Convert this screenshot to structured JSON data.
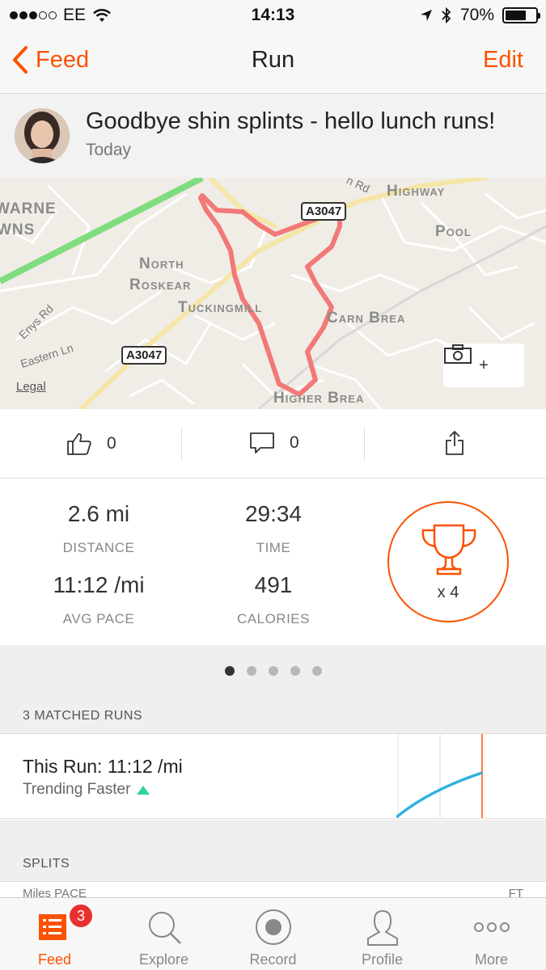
{
  "status_bar": {
    "carrier": "EE",
    "time": "14:13",
    "battery": "70%",
    "battery_level": 0.7
  },
  "nav": {
    "back_label": "Feed",
    "title": "Run",
    "edit_label": "Edit"
  },
  "activity": {
    "title": "Goodbye shin splints - hello lunch runs!",
    "date": "Today"
  },
  "map": {
    "labels": {
      "warne": "WARNE",
      "wns": "WNS",
      "north": "North",
      "roskear": "Roskear",
      "tuckingmill": "Tuckingmill",
      "highway": "Highway",
      "pool": "Pool",
      "carn_brea": "Carn Brea",
      "higher_brea": "Higher Brea",
      "enys_rd": "Enys Rd",
      "eastern_ln": "Eastern Ln",
      "rd": "n Rd",
      "a3047_top": "A3047",
      "a3047_bottom": "A3047"
    },
    "legal": "Legal",
    "photo_plus": "+"
  },
  "social": {
    "kudos_count": "0",
    "comment_count": "0"
  },
  "stats": {
    "distance": {
      "value": "2.6 mi",
      "label": "DISTANCE"
    },
    "time": {
      "value": "29:34",
      "label": "TIME"
    },
    "avg_pace": {
      "value": "11:12 /mi",
      "label": "AVG PACE"
    },
    "calories": {
      "value": "491",
      "label": "CALORIES"
    },
    "trophies": "x 4"
  },
  "pager": {
    "pages": 5,
    "active": 0
  },
  "matched": {
    "header": "3 MATCHED RUNS",
    "title": "This Run: 11:12 /mi",
    "subtitle": "Trending Faster",
    "trend_color": "#2ed3a4"
  },
  "splits": {
    "header": "SPLITS",
    "col_left": "Miles   PACE",
    "col_right": "FT"
  },
  "tabs": [
    {
      "label": "Feed",
      "icon": "feed-icon",
      "badge": "3"
    },
    {
      "label": "Explore",
      "icon": "explore-icon"
    },
    {
      "label": "Record",
      "icon": "record-icon"
    },
    {
      "label": "Profile",
      "icon": "profile-icon"
    },
    {
      "label": "More",
      "icon": "more-icon"
    }
  ],
  "colors": {
    "accent": "#fc5200",
    "route": "#f26b6b",
    "trend_line": "#2fb0e0"
  }
}
